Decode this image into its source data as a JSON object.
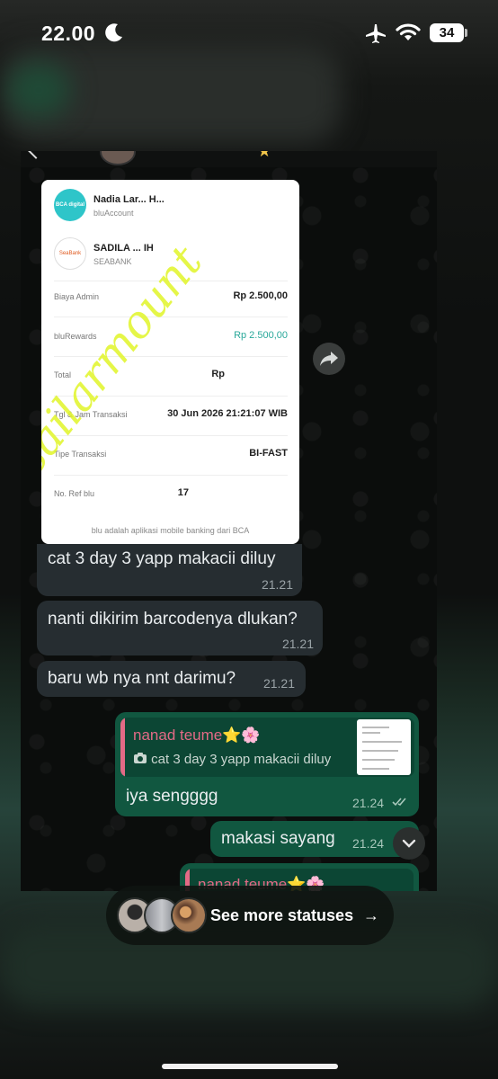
{
  "status_bar": {
    "time": "22.00",
    "battery": "34",
    "icons": [
      "moon-icon",
      "airplane-icon",
      "wifi-icon",
      "battery-icon"
    ]
  },
  "receipt": {
    "sender_bank_badge": "BCA digital",
    "sender_name": "Nadia Lar... H...",
    "sender_account_type": "bluAccount",
    "receiver_bank_badge": "SeaBank",
    "receiver_name": "SADILA ... IH",
    "receiver_bank": "SEABANK",
    "rows": [
      {
        "label": "Biaya Admin",
        "value": "Rp 2.500,00"
      },
      {
        "label": "bluRewards",
        "value": "Rp 2.500,00"
      },
      {
        "label": "Total",
        "value": "Rp"
      },
      {
        "label": "Tgl & Jam Transaksi",
        "value": "30 Jun 2026 21:21:07 WIB"
      },
      {
        "label": "Tipe Transaksi",
        "value": "BI-FAST"
      },
      {
        "label": "No. Ref blu",
        "value": "17"
      }
    ],
    "footer": "blu adalah aplikasi mobile banking dari BCA",
    "watermark": "sailarmount"
  },
  "messages": [
    {
      "text": "cat 3 day 3 yapp makacii diluy",
      "time": "21.21",
      "direction": "in"
    },
    {
      "text": "nanti dikirim barcodenya dlukan?",
      "time": "21.21",
      "direction": "in"
    },
    {
      "text": "baru wb nya nnt darimu?",
      "time": "21.21",
      "direction": "in"
    },
    {
      "text": "iya sengggg",
      "time": "21.24",
      "direction": "out"
    },
    {
      "text": "makasi sayang",
      "time": "21.24",
      "direction": "out"
    }
  ],
  "reply_quote": {
    "author": "nanad teume⭐🌸",
    "text": "cat 3 day 3 yapp makacii diluy"
  },
  "next_quote_author": "nanad teume⭐🌸",
  "status_pill": {
    "label": "See more statuses",
    "arrow": "→"
  },
  "colors": {
    "incoming_bubble": "#262d31",
    "outgoing_bubble": "#115740",
    "quote_author": "#e36a86",
    "watermark": "#e1f528"
  }
}
